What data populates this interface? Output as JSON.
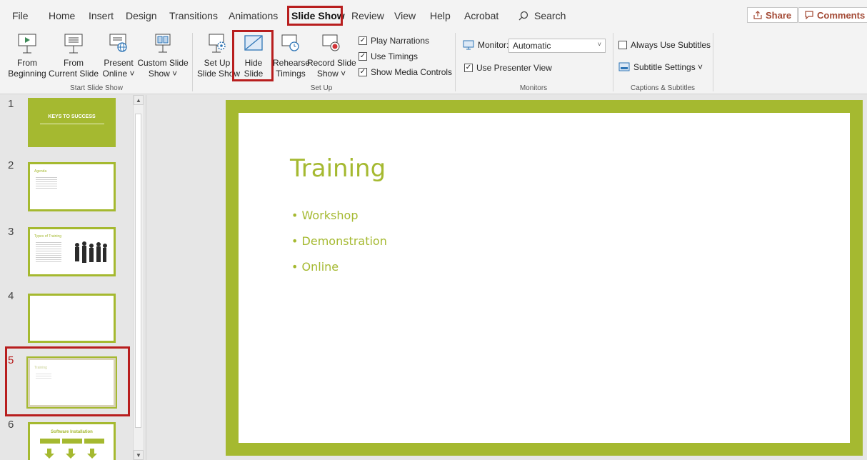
{
  "menu": {
    "tabs": [
      "File",
      "Home",
      "Insert",
      "Design",
      "Transitions",
      "Animations",
      "Slide Show",
      "Review",
      "View",
      "Help",
      "Acrobat"
    ],
    "search": "Search",
    "share": "Share",
    "comments": "Comments"
  },
  "ribbon": {
    "start": {
      "from_beginning": [
        "From",
        "Beginning"
      ],
      "from_current": [
        "From",
        "Current Slide"
      ],
      "present_online": [
        "Present",
        "Online ˅"
      ],
      "custom_show": [
        "Custom Slide",
        "Show ˅"
      ],
      "group": "Start Slide Show"
    },
    "setup": {
      "setup_show": [
        "Set Up",
        "Slide Show"
      ],
      "hide_slide": [
        "Hide",
        "Slide"
      ],
      "rehearse": [
        "Rehearse",
        "Timings"
      ],
      "record": [
        "Record Slide",
        "Show ˅"
      ],
      "play_narrations": "Play Narrations",
      "use_timings": "Use Timings",
      "show_media_controls": "Show Media Controls",
      "group": "Set Up"
    },
    "monitors": {
      "monitor_label": "Monitor:",
      "monitor_value": "Automatic",
      "presenter_view": "Use Presenter View",
      "group": "Monitors"
    },
    "captions": {
      "always_subtitles": "Always Use Subtitles",
      "subtitle_settings": "Subtitle Settings ˅",
      "group": "Captions & Subtitles"
    }
  },
  "slides": {
    "numbers": [
      "1",
      "2",
      "3",
      "4",
      "5",
      "6"
    ],
    "thumb1_title": "KEYS TO SUCCESS",
    "thumb2_title": "Agenda",
    "thumb3_title": "Types of Training",
    "thumb5_title": "Training",
    "thumb6_title": "Software Installation"
  },
  "current_slide": {
    "title": "Training",
    "bullets": [
      "Workshop",
      "Demonstration",
      "Online"
    ]
  },
  "colors": {
    "accent": "#a5b930",
    "highlight": "#b81e1e"
  }
}
